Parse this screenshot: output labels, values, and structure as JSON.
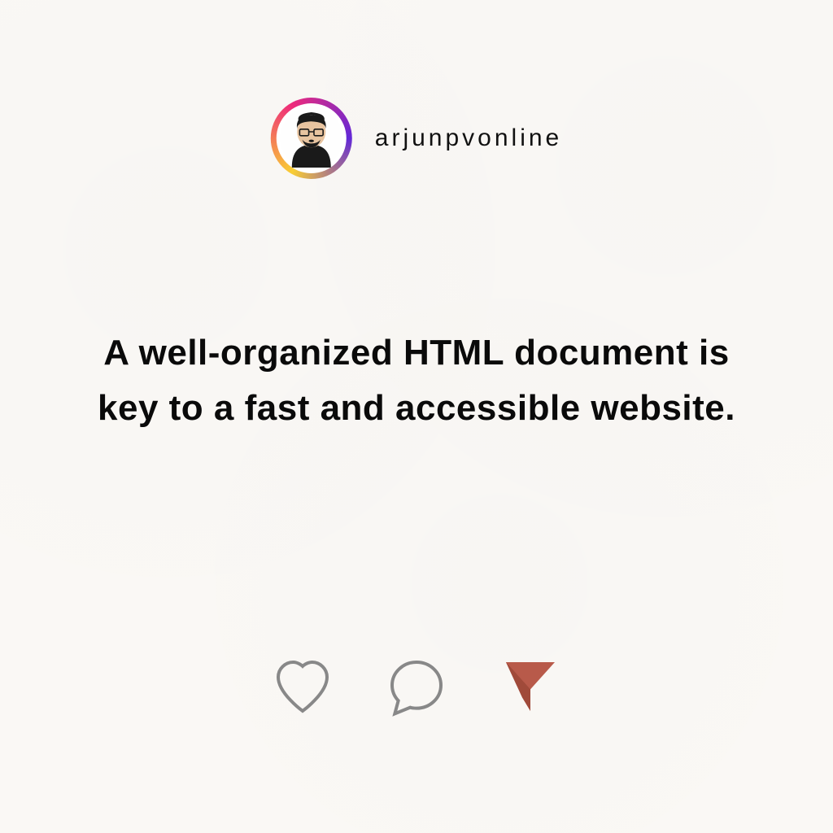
{
  "header": {
    "username": "arjunpvonline"
  },
  "content": {
    "quote": "A well-organized HTML document is key to a fast and accessible website."
  },
  "actions": {
    "like": "heart-icon",
    "comment": "comment-icon",
    "share": "send-icon"
  },
  "colors": {
    "background": "#faf8f5",
    "text": "#0a0a0a",
    "icon_stroke": "#888888",
    "share_fill": "#b85a4a",
    "gradient": [
      "#f9ce34",
      "#ee2a7b",
      "#6228d7"
    ]
  }
}
